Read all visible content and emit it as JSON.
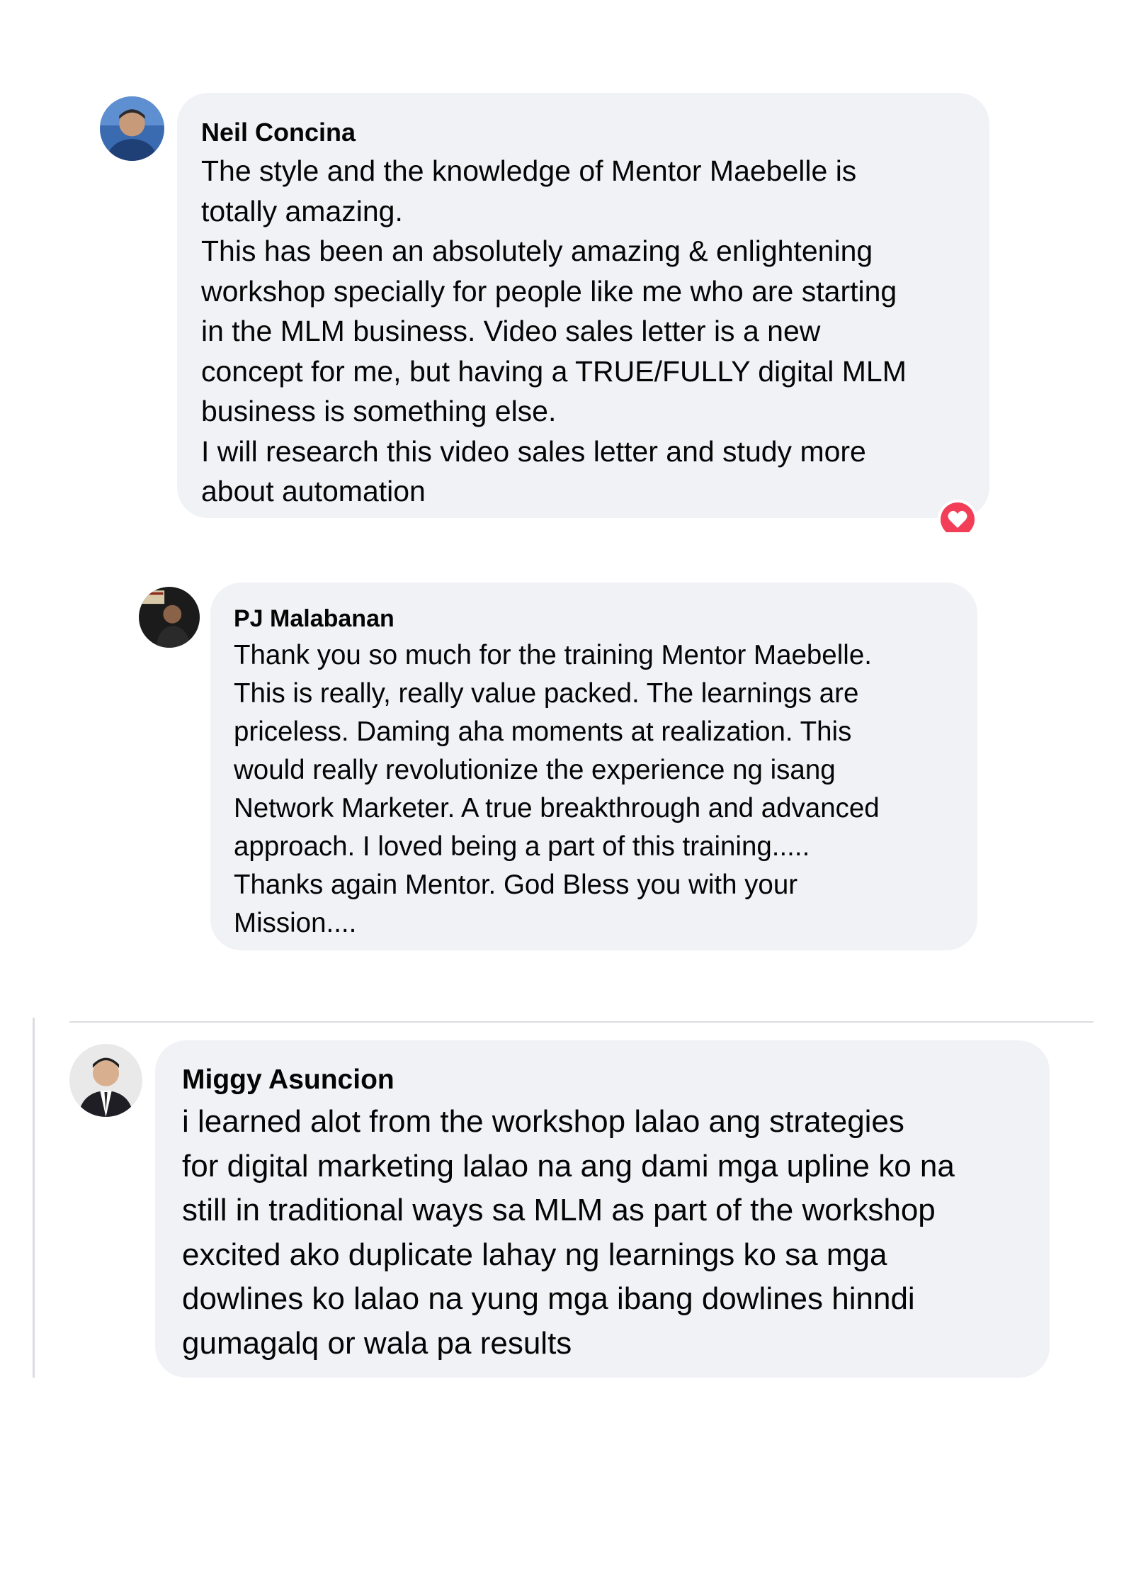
{
  "comments": [
    {
      "author": "Neil Concina",
      "text": "The style and the knowledge of Mentor Maebelle is\ntotally amazing.\nThis has been an absolutely amazing & enlightening\nworkshop specially for people like me who are starting\nin the MLM business. Video sales letter is a new\nconcept for me, but having a TRUE/FULLY digital MLM\nbusiness is something else.\nI will research this video sales letter and study more\nabout automation",
      "reaction": "heart-reaction-icon"
    },
    {
      "author": "PJ Malabanan",
      "text": "Thank you so much for the training Mentor Maebelle.\nThis is really, really value packed. The learnings are\npriceless. Daming aha moments at realization. This\nwould really revolutionize the experience ng isang\nNetwork Marketer. A true breakthrough and advanced\napproach. I loved being a part of this training.....\nThanks again Mentor. God Bless you with your\nMission...."
    },
    {
      "author": "Miggy Asuncion",
      "text": "i learned alot from the workshop lalao ang strategies\nfor digital marketing lalao na ang dami mga upline ko na\nstill in traditional ways sa MLM as part of the workshop\nexcited ako duplicate lahay ng learnings ko sa mga\ndowlines ko lalao na yung mga ibang dowlines hinndi\ngumagalq or wala pa results"
    }
  ],
  "colors": {
    "bubble": "#f0f2f5",
    "text": "#050505",
    "heart": "#f33e58",
    "divider": "#dadde1"
  }
}
